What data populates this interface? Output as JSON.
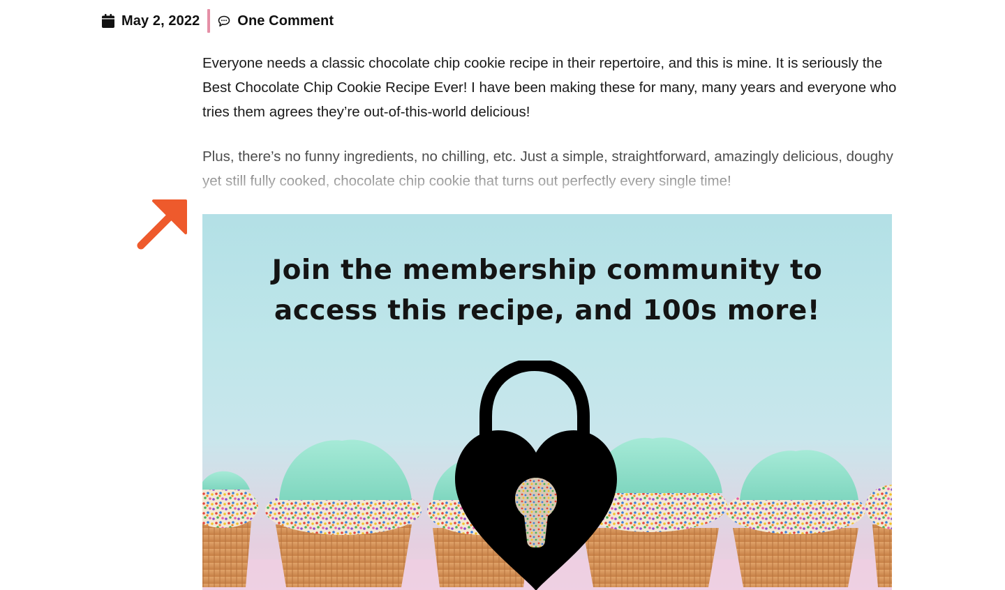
{
  "meta": {
    "date": "May 2, 2022",
    "comments": "One Comment",
    "divider_color": "#e58fa6"
  },
  "article": {
    "paragraphs": [
      "Everyone needs a classic chocolate chip cookie recipe in their repertoire, and this is mine. It is seriously the Best Chocolate Chip Cookie Recipe Ever! I have been making these for many, many years and everyone who tries them agrees they’re out-of-this-world delicious!",
      "Plus, there’s no funny ingredients, no chilling, etc. Just a simple, straightforward, amazingly delicious, doughy yet still fully cooked, chocolate chip cookie that turns out perfectly every single time!"
    ]
  },
  "annotation": {
    "arrow_icon": "arrow-up-right-icon",
    "arrow_color": "#ee5a2c"
  },
  "banner": {
    "headline_line1": "Join the membership community to",
    "headline_line2": "access this recipe, and 100s more!",
    "image": "cupcakes-with-sprinkles",
    "lock_icon": "heart-padlock-icon"
  },
  "icons": {
    "date": "calendar-icon",
    "comments": "speech-bubble-icon"
  }
}
